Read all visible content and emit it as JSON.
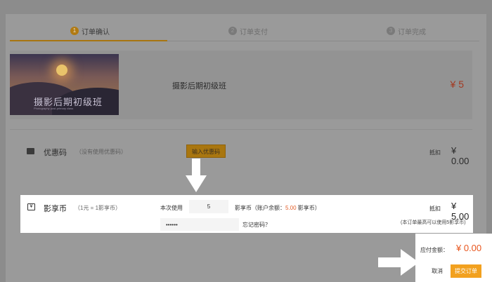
{
  "steps": [
    {
      "num": "1",
      "label": "订单确认"
    },
    {
      "num": "2",
      "label": "订单支付"
    },
    {
      "num": "3",
      "label": "订单完成"
    }
  ],
  "product": {
    "thumb_title": "摄影后期初级班",
    "thumb_sub": "Photography post-primary class",
    "name": "摄影后期初级班",
    "price": "¥ 5"
  },
  "coupon": {
    "label": "优惠码",
    "hint": "（没有使用优惠码）",
    "button": "输入优惠码",
    "deduct_label": "抵扣",
    "deduct_amount": "¥ 0.00"
  },
  "points": {
    "icon_glyph": "¥",
    "label": "影享币",
    "rate": "（1元 = 1影享币）",
    "use_label": "本次使用",
    "use_value": "5",
    "balance_prefix": "影享币（账户余额：",
    "balance_value": "5.00",
    "balance_suffix": " 影享币）",
    "password_value": "••••••",
    "forgot": "忘记密码？",
    "deduct_label": "抵扣",
    "deduct_amount": "¥ 5.00",
    "limit_note": "(本订单最高可以使用5影享币)"
  },
  "payment": {
    "label": "应付金额：",
    "amount": "¥ 0.00",
    "cancel": "取消",
    "submit": "提交订单"
  },
  "colors": {
    "accent": "#f2a11f",
    "price_red": "#e8561e"
  }
}
